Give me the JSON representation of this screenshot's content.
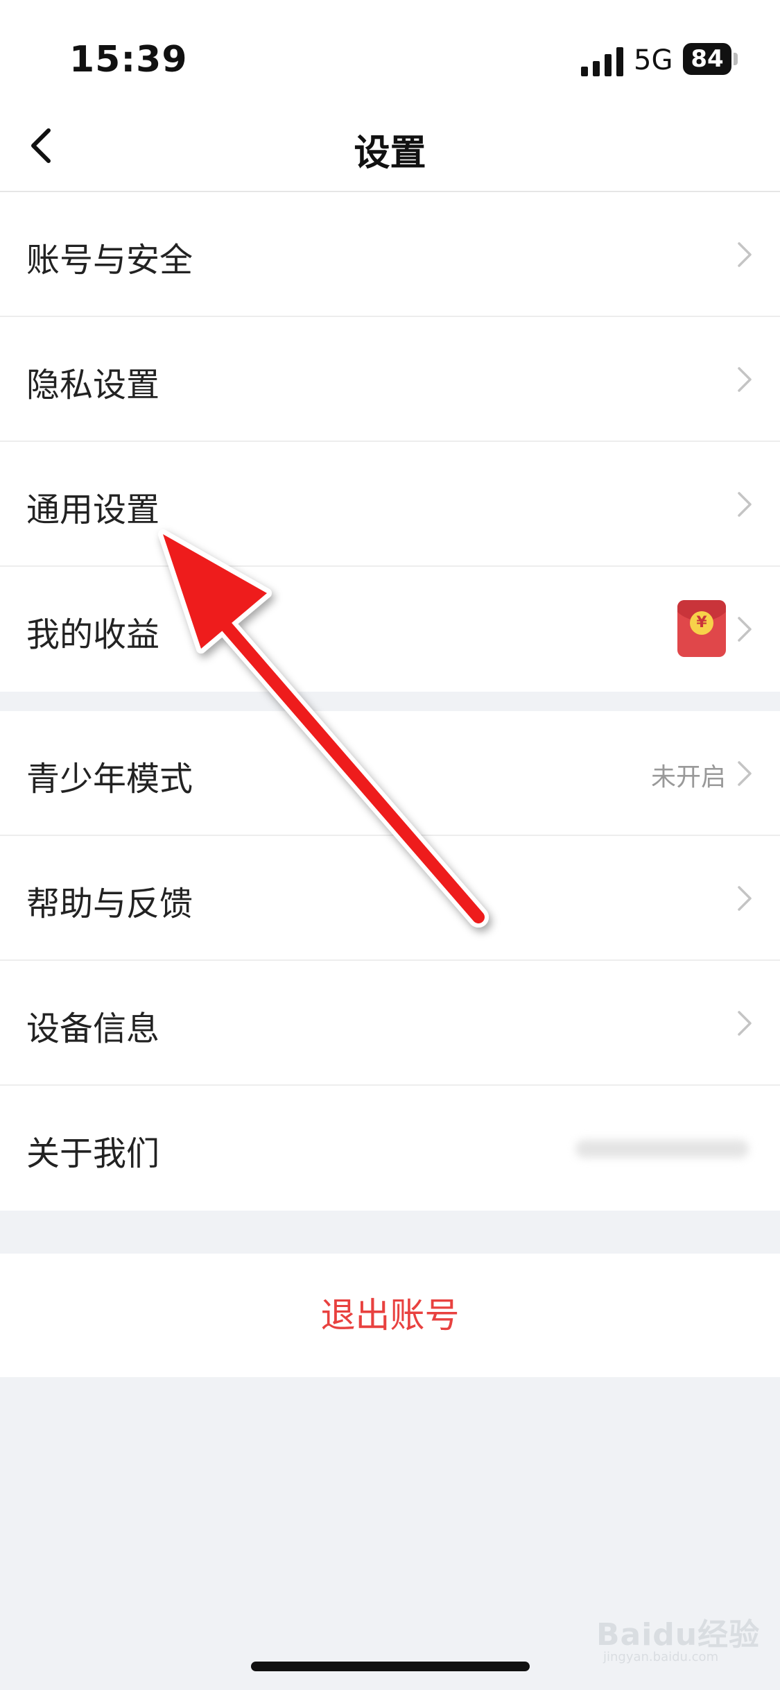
{
  "status_bar": {
    "time": "15:39",
    "network": "5G",
    "battery": "84"
  },
  "nav": {
    "title": "设置"
  },
  "groups": [
    {
      "items": [
        {
          "label": "账号与安全"
        },
        {
          "label": "隐私设置"
        },
        {
          "label": "通用设置"
        },
        {
          "label": "我的收益",
          "icon": "red-envelope-icon"
        }
      ]
    },
    {
      "items": [
        {
          "label": "青少年模式",
          "value": "未开启"
        },
        {
          "label": "帮助与反馈"
        },
        {
          "label": "设备信息"
        },
        {
          "label": "关于我们",
          "value_redacted": true
        }
      ]
    }
  ],
  "logout": {
    "label": "退出账号"
  },
  "watermark": {
    "main": "Baidu经验",
    "sub": "jingyan.baidu.com"
  },
  "colors": {
    "accent_red": "#e8413f",
    "annotation_arrow": "#ee1c1c",
    "page_background": "#f0f2f5"
  }
}
